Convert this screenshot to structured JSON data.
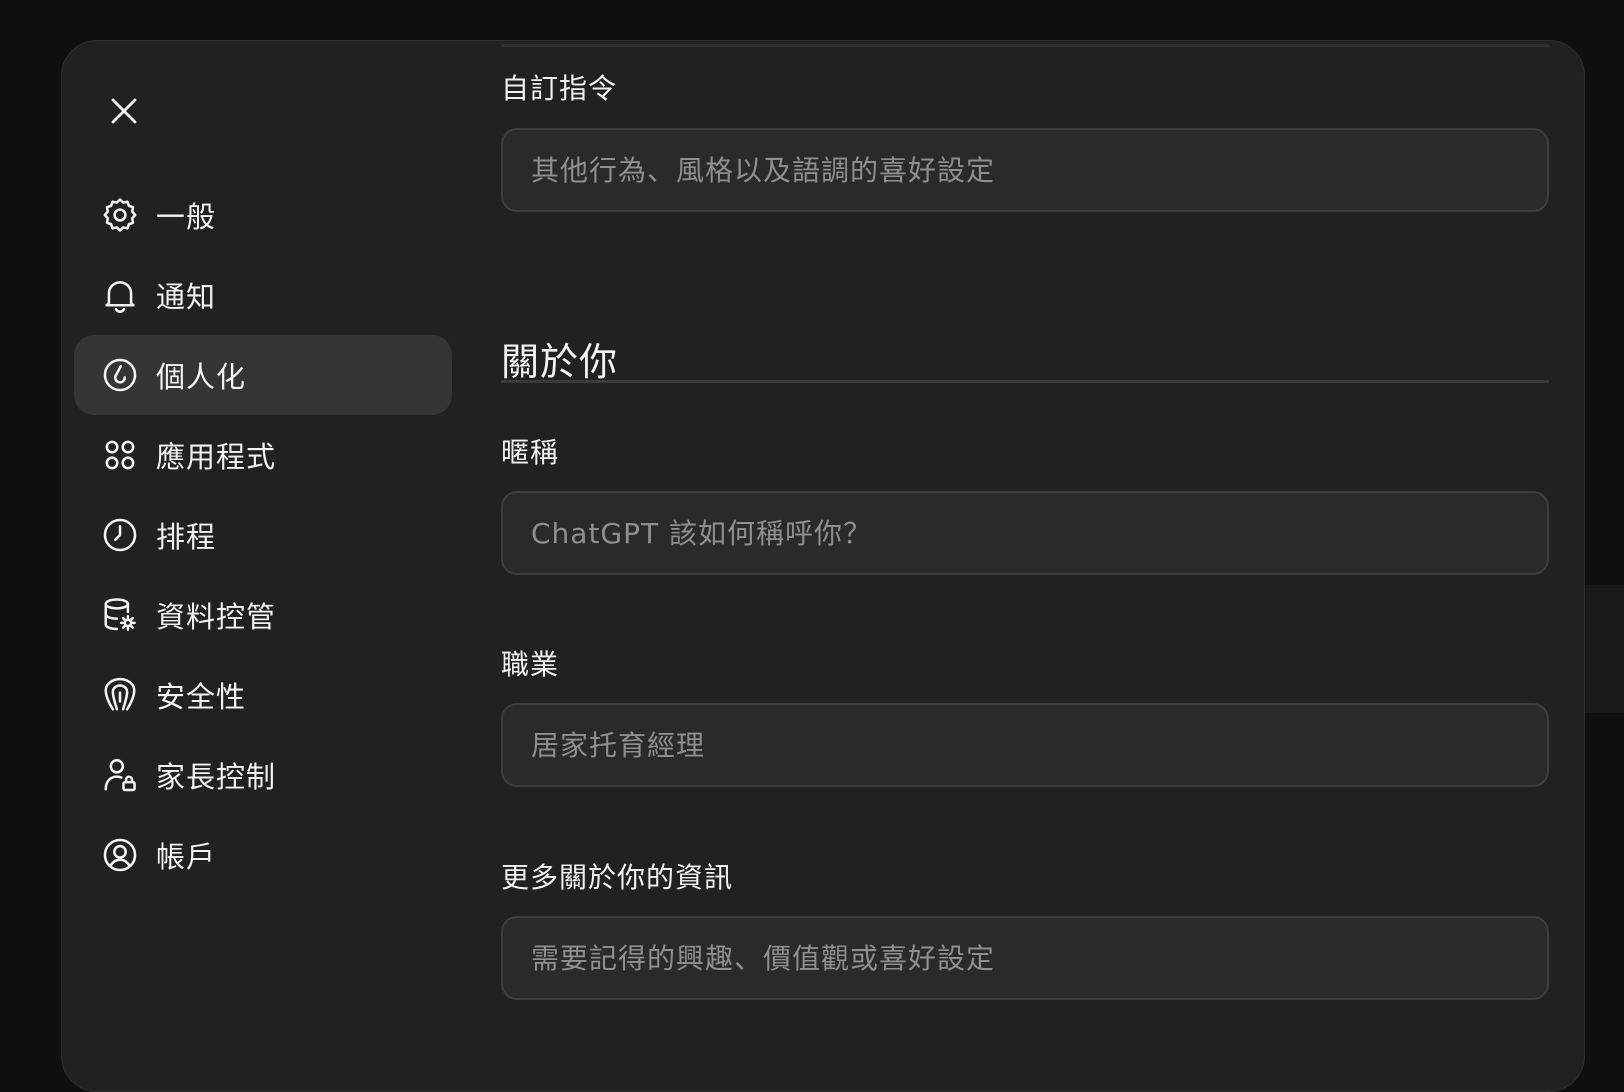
{
  "nav": {
    "close_icon": "close-icon",
    "items": [
      {
        "label": "一般",
        "icon": "gear-icon"
      },
      {
        "label": "通知",
        "icon": "bell-icon"
      },
      {
        "label": "個人化",
        "icon": "personalization-icon",
        "active": true
      },
      {
        "label": "應用程式",
        "icon": "apps-grid-icon"
      },
      {
        "label": "排程",
        "icon": "clock-icon"
      },
      {
        "label": "資料控管",
        "icon": "database-gear-icon"
      },
      {
        "label": "安全性",
        "icon": "security-icon"
      },
      {
        "label": "家長控制",
        "icon": "person-lock-icon"
      },
      {
        "label": "帳戶",
        "icon": "user-circle-icon"
      }
    ]
  },
  "content": {
    "custom_instructions": {
      "label": "自訂指令",
      "placeholder": "其他行為、風格以及語調的喜好設定",
      "value": ""
    },
    "about_you": {
      "heading": "關於你"
    },
    "nickname": {
      "label": "暱稱",
      "placeholder": "ChatGPT 該如何稱呼你？",
      "value": ""
    },
    "occupation": {
      "label": "職業",
      "placeholder": "居家托育經理",
      "value": ""
    },
    "more_about_you": {
      "label": "更多關於你的資訊",
      "placeholder": "需要記得的興趣、價值觀或喜好設定",
      "value": ""
    }
  },
  "colors": {
    "background": "#0f0f0f",
    "modal": "#212121",
    "active_nav": "#353535",
    "input_bg": "#2a2a2a",
    "input_border": "#3e3e3e",
    "text": "#f2f2f2",
    "placeholder": "#8f8f8f"
  }
}
